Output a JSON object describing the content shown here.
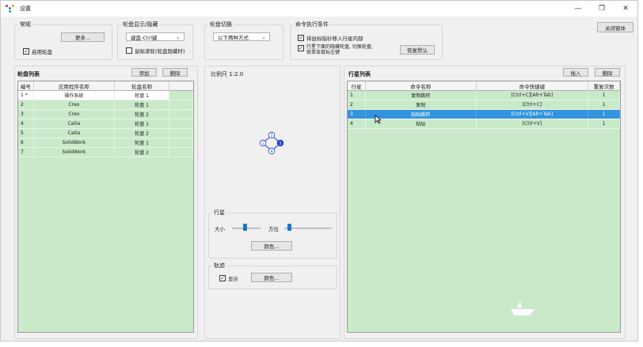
{
  "window": {
    "title": "设置",
    "min": "—",
    "max": "❐",
    "close": "✕"
  },
  "routine": {
    "label": "常规",
    "more_button": "更多...",
    "enable_wheel": "启用轮盘",
    "enable_checked": true
  },
  "wheel_show_hide": {
    "label": "轮盘显示/隐藏",
    "combo_value": "键盘-Ctrl键",
    "mouse_wheel_text": "鼠标滚轮(轮盘隐藏时)",
    "mouse_wheel_checked": false
  },
  "wheel_switch": {
    "label": "轮盘切换",
    "combo_value": "以下两种方式"
  },
  "cmd_condition": {
    "label": "命令执行条件",
    "opt1": "将鼠标指针移入行星内部",
    "opt1_checked": true,
    "opt2_line1": "行星下面的隐藏轮盘, 切换轮盘,",
    "opt2_line2": "就单击鼠标左键",
    "opt2_checked": true,
    "reset_button": "恢复默认"
  },
  "close_form_button": "关闭窗体",
  "wheel_list": {
    "title": "轮盘列表",
    "add_button": "添加",
    "delete_button": "删除",
    "columns": [
      "编号",
      "应用程序名称",
      "轮盘名称"
    ],
    "rows": [
      {
        "no": "1 *",
        "app": "操作系统",
        "wheel": "轮盘 1"
      },
      {
        "no": "2",
        "app": "Creo",
        "wheel": "轮盘 1"
      },
      {
        "no": "3",
        "app": "Creo",
        "wheel": "轮盘 2"
      },
      {
        "no": "4",
        "app": "Catia",
        "wheel": "轮盘 1"
      },
      {
        "no": "5",
        "app": "Catia",
        "wheel": "轮盘 2"
      },
      {
        "no": "6",
        "app": "SolidWork",
        "wheel": "轮盘 1"
      },
      {
        "no": "7",
        "app": "SolidWork",
        "wheel": "轮盘 2"
      }
    ]
  },
  "preview": {
    "scale_label": "比例尺 1:2.0",
    "nodes": [
      "1",
      "2",
      "3",
      "4"
    ]
  },
  "planet": {
    "label": "行星",
    "size_label": "大小",
    "azimuth_label": "方位",
    "size_value": 0.45,
    "azimuth_value": 0.1,
    "color_button": "颜色..."
  },
  "trail": {
    "label": "轨迹",
    "show_label": "显示",
    "show_checked": true,
    "color_button": "颜色..."
  },
  "planet_list": {
    "title": "行星列表",
    "insert_button": "插入",
    "delete_button": "删除",
    "columns": [
      "行星",
      "命令名称",
      "命令快捷键",
      "重复次数"
    ],
    "rows": [
      {
        "no": "1",
        "name": "复制跳转",
        "key": "[Ctrl+C][Alt+Tab]",
        "repeat": "1"
      },
      {
        "no": "2",
        "name": "复制",
        "key": "[Ctrl+C]",
        "repeat": "1"
      },
      {
        "no": "3",
        "name": "粘贴跳转",
        "key": "[Ctrl+V][Alt+Tab]",
        "repeat": "1"
      },
      {
        "no": "4",
        "name": "粘贴",
        "key": "[Ctrl+V]",
        "repeat": "1"
      }
    ],
    "selected_index": 2
  },
  "colors": {
    "grid_green": "#c9e9c9",
    "selection_blue": "#3393df",
    "node_blue": "#1a3fd8"
  }
}
